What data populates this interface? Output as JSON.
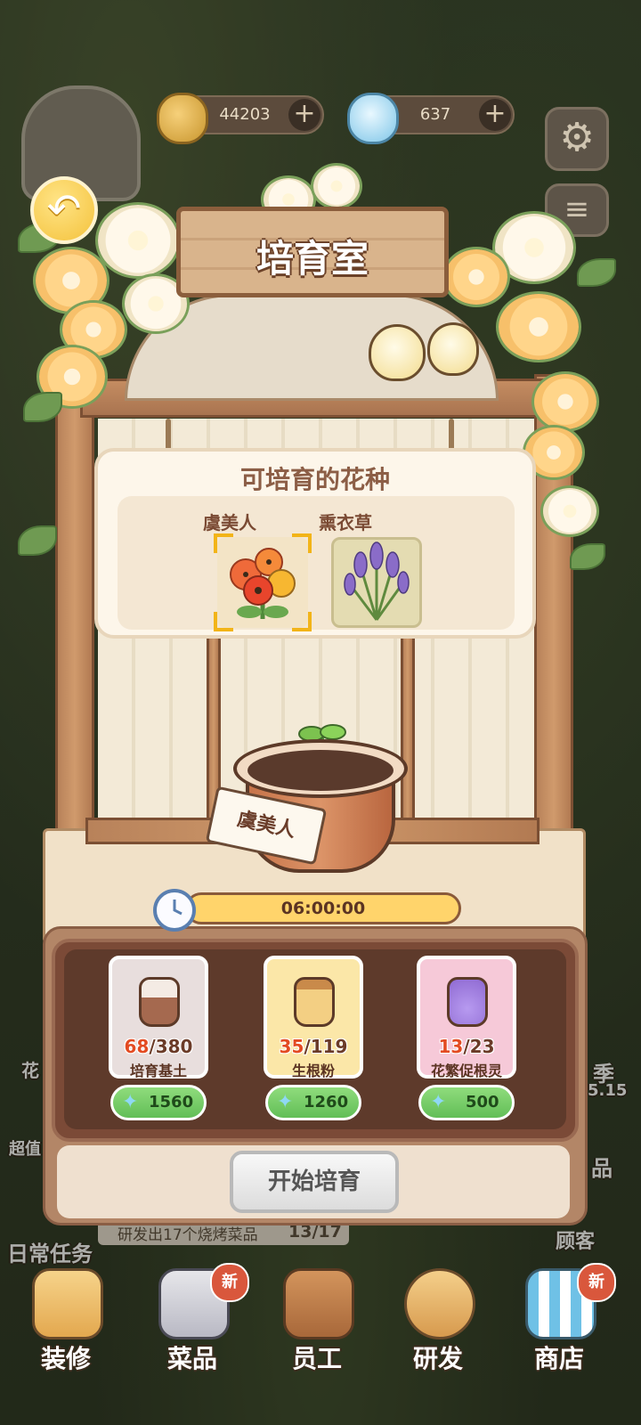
{
  "currency": {
    "coins": "44203",
    "gems": "637",
    "plus": "+"
  },
  "back_icon": "↶",
  "sign_title": "培育室",
  "panel": {
    "title": "可培育的花种",
    "flowers": [
      {
        "name": "虞美人",
        "selected": true
      },
      {
        "name": "熏衣草",
        "selected": false
      }
    ]
  },
  "pot_tag": "虞美人",
  "timer": "06:00:00",
  "materials": [
    {
      "have": "68",
      "need": "/380",
      "name": "培育基土",
      "price": "1560",
      "card_color": "#e8dedd",
      "jar_color": "#a5694f"
    },
    {
      "have": "35",
      "need": "/119",
      "name": "生根粉",
      "price": "1260",
      "card_color": "#fbe7a8",
      "jar_color": "#e0b066"
    },
    {
      "have": "13",
      "need": "/23",
      "name": "花繁促根灵",
      "price": "500",
      "card_color": "#f6c9d8",
      "jar_color": "#9b7ad6"
    }
  ],
  "start_button": "开始培育",
  "background": {
    "daily_tasks": "日常任务",
    "task_text": "研发出17个烧烤菜品",
    "task_progress": "13/17",
    "customer": "顾客",
    "left_flower": "花",
    "left_deal": "超值",
    "right_season": "季",
    "right_date": "5.15",
    "right_goods": "品"
  },
  "nav": [
    {
      "label": "装修",
      "icon": "hammer-icon",
      "new": false
    },
    {
      "label": "菜品",
      "icon": "utensils-icon",
      "new": true
    },
    {
      "label": "员工",
      "icon": "clipboard-icon",
      "new": false
    },
    {
      "label": "研发",
      "icon": "pot-icon",
      "new": false
    },
    {
      "label": "商店",
      "icon": "shop-icon",
      "new": true
    }
  ],
  "new_badge": "新",
  "icons": {
    "settings": "gear-icon",
    "menu": "menu-icon",
    "gem_glyph": "✦"
  }
}
